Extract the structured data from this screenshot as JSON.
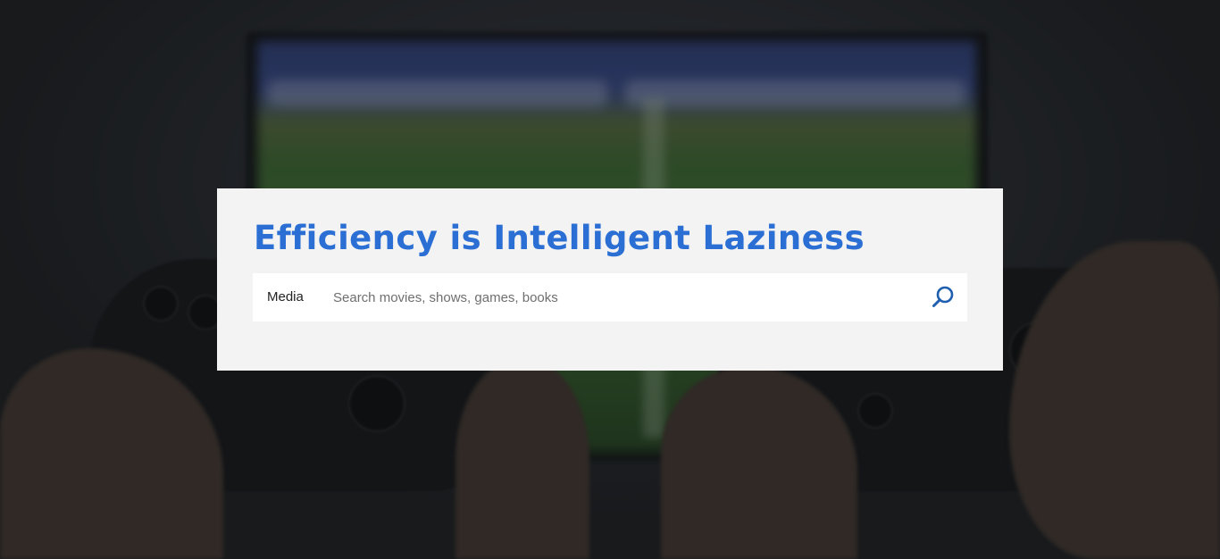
{
  "hero": {
    "title": "Efficiency is Intelligent Laziness",
    "background": "dimmed photo of hands holding game controllers in front of a TV"
  },
  "search": {
    "category_label": "Media",
    "placeholder": "Search movies, shows, games, books",
    "value": "",
    "icon": "search-icon"
  },
  "colors": {
    "title": "#2b6fd4",
    "card_background": "#f3f3f3",
    "search_icon": "#1f5fb0"
  }
}
